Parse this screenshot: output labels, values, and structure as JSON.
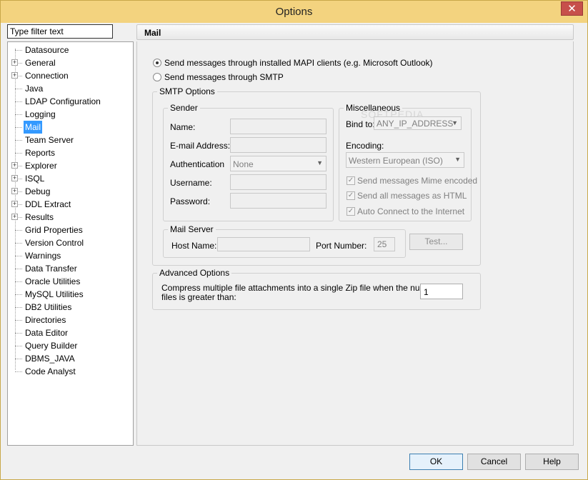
{
  "window": {
    "title": "Options",
    "close_glyph": "✕"
  },
  "filter": {
    "placeholder": "Type filter text"
  },
  "tree": {
    "items": [
      {
        "label": "Datasource",
        "expandable": false
      },
      {
        "label": "General",
        "expandable": true
      },
      {
        "label": "Connection",
        "expandable": true
      },
      {
        "label": "Java",
        "expandable": false
      },
      {
        "label": "LDAP Configuration",
        "expandable": false
      },
      {
        "label": "Logging",
        "expandable": false
      },
      {
        "label": "Mail",
        "expandable": false,
        "selected": true
      },
      {
        "label": "Team Server",
        "expandable": false
      },
      {
        "label": "Reports",
        "expandable": false
      },
      {
        "label": "Explorer",
        "expandable": true
      },
      {
        "label": "ISQL",
        "expandable": true
      },
      {
        "label": "Debug",
        "expandable": true
      },
      {
        "label": "DDL Extract",
        "expandable": true
      },
      {
        "label": "Results",
        "expandable": true
      },
      {
        "label": "Grid Properties",
        "expandable": false
      },
      {
        "label": "Version Control",
        "expandable": false
      },
      {
        "label": "Warnings",
        "expandable": false
      },
      {
        "label": "Data Transfer",
        "expandable": false
      },
      {
        "label": "Oracle Utilities",
        "expandable": false
      },
      {
        "label": "MySQL Utilities",
        "expandable": false
      },
      {
        "label": "DB2 Utilities",
        "expandable": false
      },
      {
        "label": "Directories",
        "expandable": false
      },
      {
        "label": "Data Editor",
        "expandable": false
      },
      {
        "label": "Query Builder",
        "expandable": false
      },
      {
        "label": "DBMS_JAVA",
        "expandable": false
      },
      {
        "label": "Code Analyst",
        "expandable": false
      }
    ]
  },
  "page": {
    "header": "Mail",
    "radio_mapi": "Send messages through installed MAPI clients (e.g. Microsoft Outlook)",
    "radio_smtp": "Send messages through SMTP",
    "smtp_group": "SMTP Options",
    "sender_group": "Sender",
    "name_label": "Name:",
    "email_label": "E-mail Address:",
    "auth_label": "Authentication",
    "auth_value": "None",
    "username_label": "Username:",
    "password_label": "Password:",
    "misc_group": "Miscellaneous",
    "bind_label": "Bind to:",
    "bind_value": "ANY_IP_ADDRESS",
    "encoding_label": "Encoding:",
    "encoding_value": "Western European (ISO)",
    "check_mime": "Send messages Mime encoded",
    "check_html": "Send all messages as HTML",
    "check_auto": "Auto Connect to the Internet",
    "mailserver_group": "Mail Server",
    "host_label": "Host Name:",
    "port_label": "Port Number:",
    "port_value": "25",
    "test_button": "Test...",
    "advanced_group": "Advanced Options",
    "compress_text_1": "Compress multiple file attachments into a single Zip file when the number of",
    "compress_text_2": "files is greater than:",
    "compress_value": "1"
  },
  "footer": {
    "ok": "OK",
    "cancel": "Cancel",
    "help": "Help"
  },
  "watermark": "SOFTPEDIA"
}
